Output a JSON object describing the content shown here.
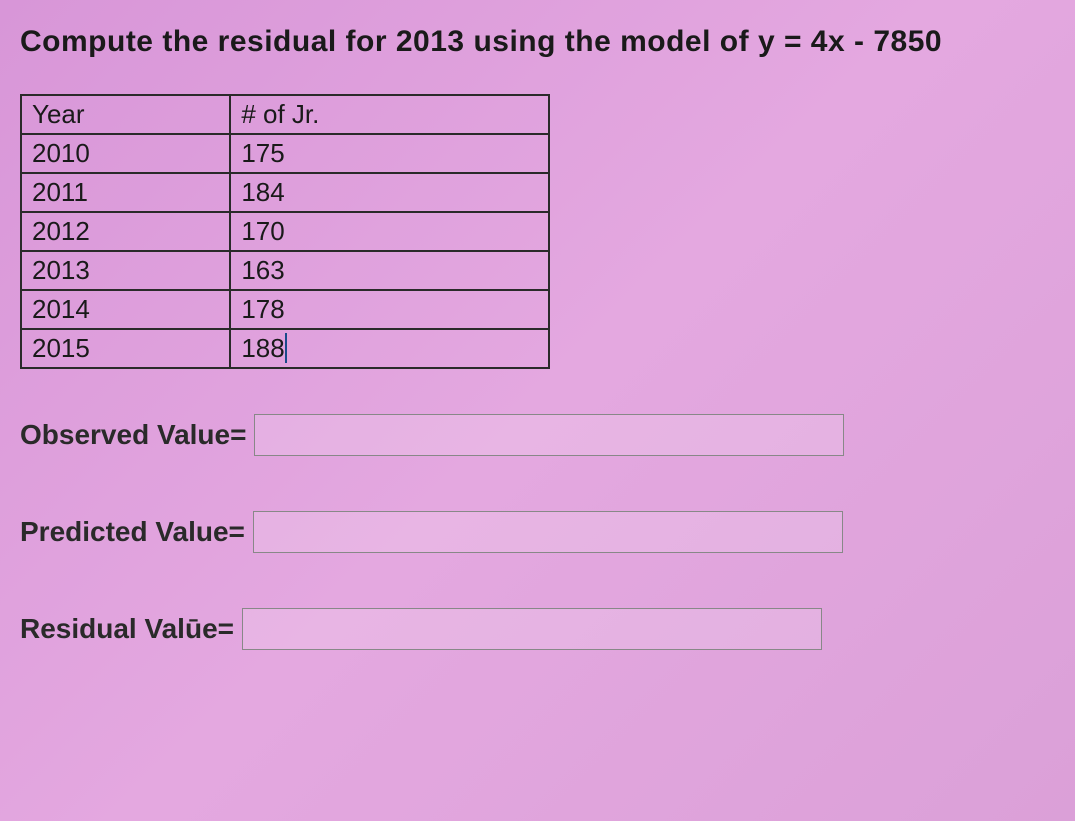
{
  "question": "Compute the residual for 2013 using the model of y = 4x - 7850",
  "table": {
    "headers": {
      "col1": "Year",
      "col2": "# of Jr."
    },
    "rows": [
      {
        "year": "2010",
        "num": "175"
      },
      {
        "year": "2011",
        "num": "184"
      },
      {
        "year": "2012",
        "num": "170"
      },
      {
        "year": "2013",
        "num": "163"
      },
      {
        "year": "2014",
        "num": "178"
      },
      {
        "year": "2015",
        "num": "188"
      }
    ]
  },
  "inputs": {
    "observed": {
      "label": "Observed Value=",
      "value": ""
    },
    "predicted": {
      "label": "Predicted Value=",
      "value": ""
    },
    "residual": {
      "label": "Residual Valūe=",
      "value": ""
    }
  },
  "chart_data": {
    "type": "table",
    "title": "Compute the residual for 2013 using the model of y = 4x - 7850",
    "columns": [
      "Year",
      "# of Jr."
    ],
    "data": [
      [
        2010,
        175
      ],
      [
        2011,
        184
      ],
      [
        2012,
        170
      ],
      [
        2013,
        163
      ],
      [
        2014,
        178
      ],
      [
        2015,
        188
      ]
    ],
    "model": "y = 4x - 7850",
    "target_year": 2013
  }
}
